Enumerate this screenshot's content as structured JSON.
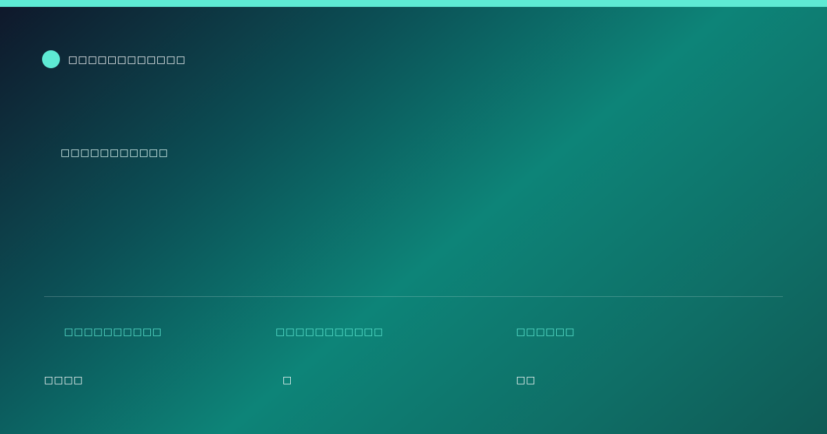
{
  "colors": {
    "accent": "#5eead4"
  },
  "brand": {
    "icon": "circle-logo-icon",
    "name": "□□□□□□□□□□□□"
  },
  "headline": "□□□□□□□□□□□",
  "stats": [
    {
      "label": "□□□□□□□□□□",
      "value": "□□□□"
    },
    {
      "label": "□□□□□□□□□□□",
      "value": "□"
    },
    {
      "label": "□□□□□□",
      "value": "□□"
    }
  ]
}
